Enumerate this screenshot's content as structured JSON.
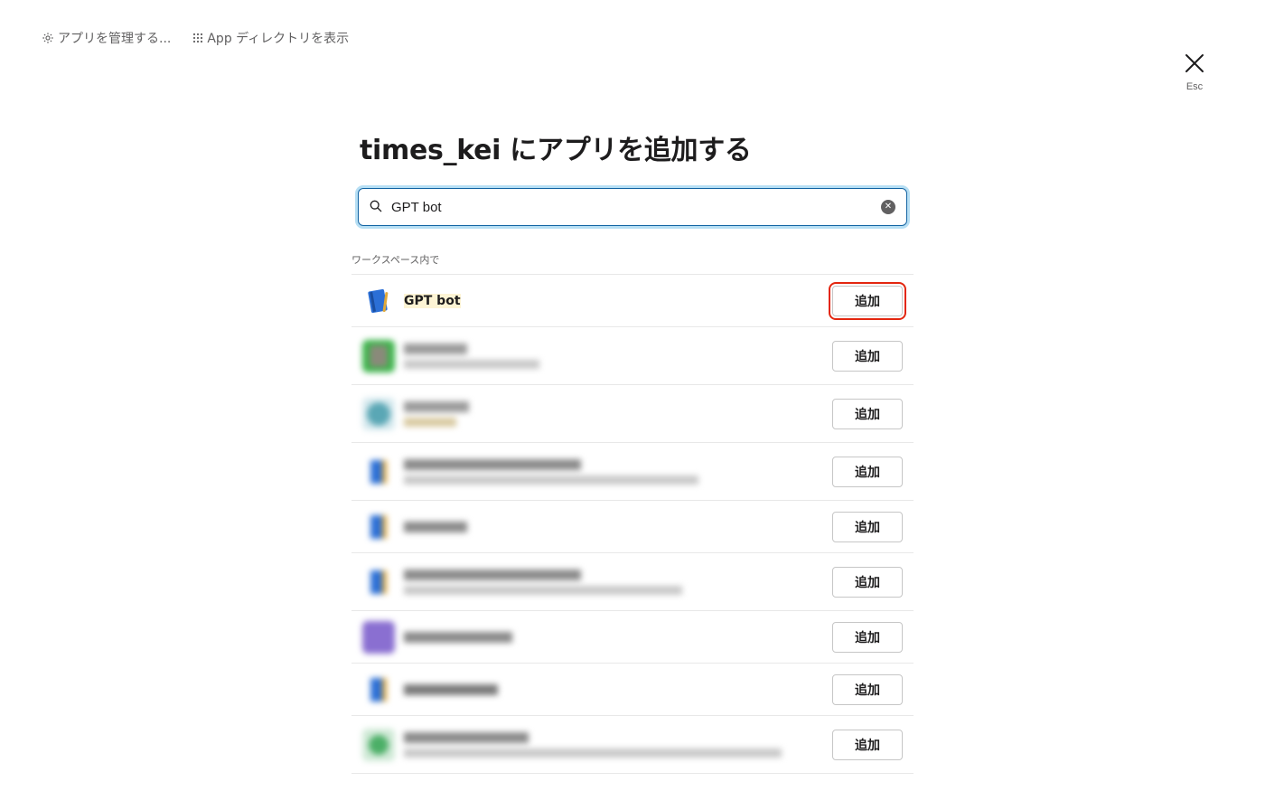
{
  "topbar": {
    "manage_label": "アプリを管理する...",
    "directory_label": "App ディレクトリを表示"
  },
  "close": {
    "esc_label": "Esc"
  },
  "title": "times_kei にアプリを追加する",
  "search": {
    "value": "GPT bot"
  },
  "section_label": "ワークスペース内で",
  "results": [
    {
      "name_pre": "",
      "name_mark": "GPT bot",
      "desc": "",
      "add_label": "追加",
      "icon": "notebook-icon",
      "icon_color": "#2b6fd6"
    },
    {
      "name_pre": "",
      "name_mark": "",
      "desc": "",
      "add_label": "追加",
      "icon": "avatar-green-icon",
      "icon_color": "#3bb54a"
    },
    {
      "name_pre": "",
      "name_mark": "",
      "desc": "",
      "add_label": "追加",
      "icon": "globe-icon",
      "icon_color": "#5aa7b5"
    },
    {
      "name_pre": "",
      "name_mark": "",
      "desc": "",
      "add_label": "追加",
      "icon": "notebook-icon",
      "icon_color": "#2b6fd6"
    },
    {
      "name_pre": "",
      "name_mark": "",
      "desc": "",
      "add_label": "追加",
      "icon": "notebook-icon",
      "icon_color": "#2b6fd6"
    },
    {
      "name_pre": "",
      "name_mark": "",
      "desc": "",
      "add_label": "追加",
      "icon": "notebook-icon",
      "icon_color": "#2b6fd6"
    },
    {
      "name_pre": "",
      "name_mark": "",
      "desc": "",
      "add_label": "追加",
      "icon": "purple-app-icon",
      "icon_color": "#8a6fd1"
    },
    {
      "name_pre": "",
      "name_mark": "",
      "desc": "",
      "add_label": "追加",
      "icon": "notebook-icon",
      "icon_color": "#2b6fd6"
    },
    {
      "name_pre": "",
      "name_mark": "",
      "desc": "",
      "add_label": "追加",
      "icon": "green-app-icon",
      "icon_color": "#4caf67"
    }
  ],
  "colors": {
    "accent": "#1264a3",
    "highlight": "#e3260f",
    "mark": "#fdf4d4"
  }
}
